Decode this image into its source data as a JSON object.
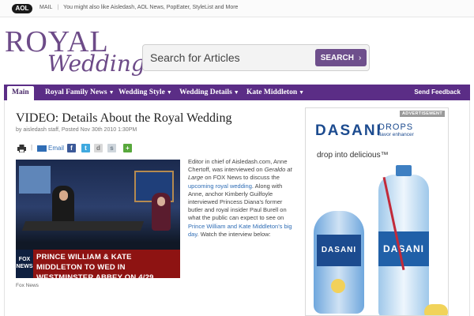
{
  "topbar": {
    "logo": "AOL",
    "mail": "MAIL",
    "also_like": "You might also like Aisledash, AOL News, PopEater, StyleList and  More"
  },
  "logo": {
    "line1": "ROYAL",
    "line2": "Wedding"
  },
  "search": {
    "placeholder": "Search for Articles",
    "button": "SEARCH",
    "button_icon": "chevron-right-icon"
  },
  "nav": {
    "items": [
      {
        "label": "Main",
        "active": true
      },
      {
        "label": "Royal Family News",
        "dropdown": true
      },
      {
        "label": "Wedding Style",
        "dropdown": true
      },
      {
        "label": "Wedding Details",
        "dropdown": true
      },
      {
        "label": "Kate Middleton",
        "dropdown": true
      }
    ],
    "feedback": "Send Feedback",
    "color": "#5b2d86"
  },
  "article": {
    "title": "VIDEO: Details About the Royal Wedding",
    "byline": "by aisledash staff, Posted Nov 30th 2010 1:30PM",
    "share": {
      "email": "Email",
      "icons": [
        "print-icon",
        "email-icon",
        "facebook-icon",
        "twitter-icon",
        "digg-icon",
        "stumbleupon-icon",
        "share-icon"
      ]
    },
    "video_chyron": "PRINCE WILLIAM & KATE MIDDLETON TO WED IN WESTMINSTER ABBEY ON 4/29",
    "video_network": "FOX NEWS",
    "caption": "Fox News",
    "body": {
      "p1": "Editor in chief of Aisledash.com, Anne Chertoff, was interviewed on ",
      "show": "Geraldo at Large",
      "p2": " on FOX News to discuss the ",
      "link1": "upcoming royal wedding",
      "p3": ". Along with Anne, anchor Kimberly Guilfoyle interviewed Princess Diana's former butler and royal insider Paul Burell on what the public can expect to see on ",
      "link2": "Prince William and Kate Middleton's big day",
      "p4": ". Watch the interview below:"
    }
  },
  "ad": {
    "badge": "ADVERTISEMENT",
    "brand": "DASANI",
    "drops": "DROPS",
    "flavor": "flavor enhancer",
    "tagline": "drop into delicious™",
    "bottle_label": "DASANI"
  }
}
